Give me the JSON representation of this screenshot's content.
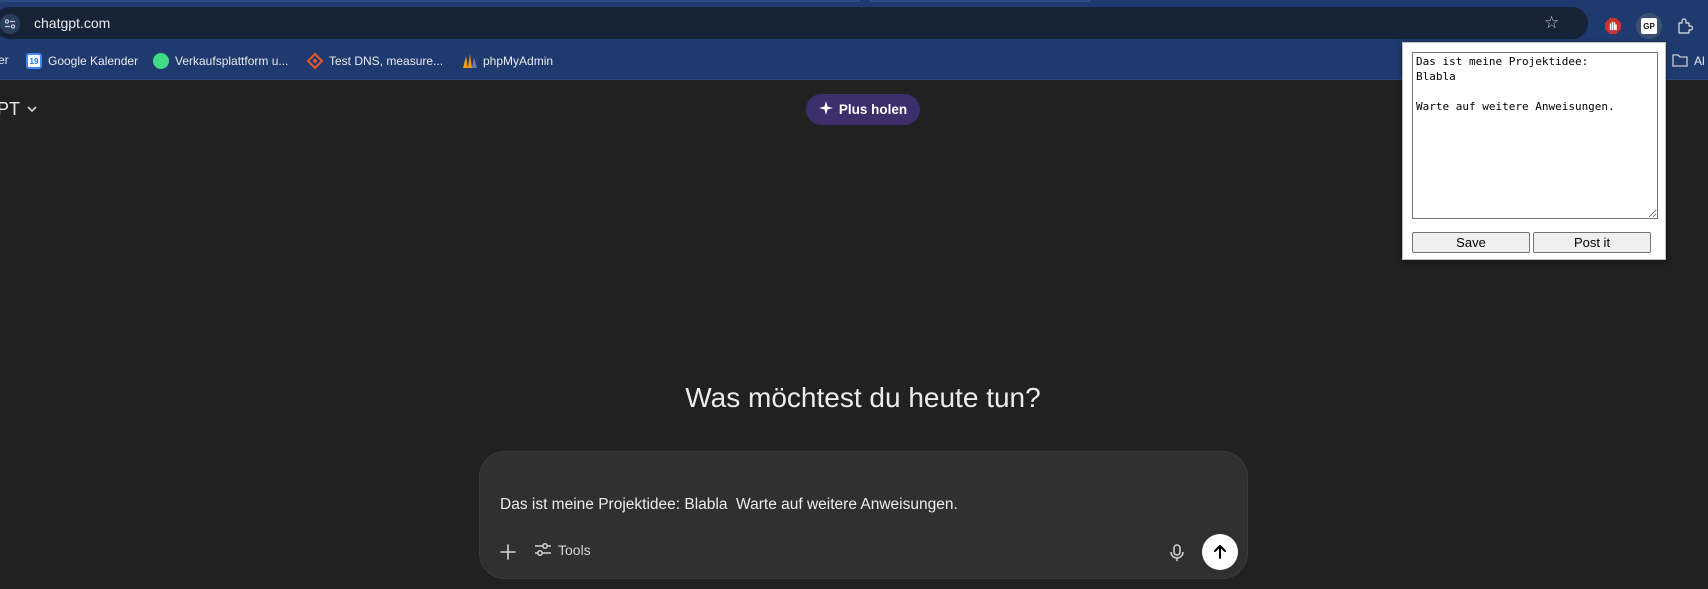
{
  "browser": {
    "url": "chatgpt.com",
    "bookmarks": [
      {
        "label": "er",
        "icon": "none"
      },
      {
        "label": "Google Kalender",
        "icon": "google-calendar-icon"
      },
      {
        "label": "Verkaufsplattform u...",
        "icon": "shop-icon"
      },
      {
        "label": "Test DNS, measure...",
        "icon": "dns-icon"
      },
      {
        "label": "phpMyAdmin",
        "icon": "phpmyadmin-icon"
      },
      {
        "label": "Al",
        "icon": "folder-icon"
      }
    ],
    "extensions": [
      "adblock-icon",
      "gp-extension-icon",
      "puzzle-icon"
    ],
    "gp_badge": "GP",
    "calendar_day": "19"
  },
  "app": {
    "model_label": "PT",
    "plus_button": "Plus holen",
    "headline": "Was möchtest du heute tun?",
    "composer_text": "Das ist meine Projektidee: Blabla  Warte auf weitere Anweisungen.",
    "tools_label": "Tools"
  },
  "popup": {
    "textarea_value": "Das ist meine Projektidee:\nBlabla\n\nWarte auf weitere Anweisungen.",
    "save_label": "Save",
    "post_label": "Post it"
  },
  "colors": {
    "browser_frame": "#1f3a6e",
    "page_bg": "#212121",
    "composer_bg": "#303030",
    "plus_pill": "#3b2e6b"
  }
}
